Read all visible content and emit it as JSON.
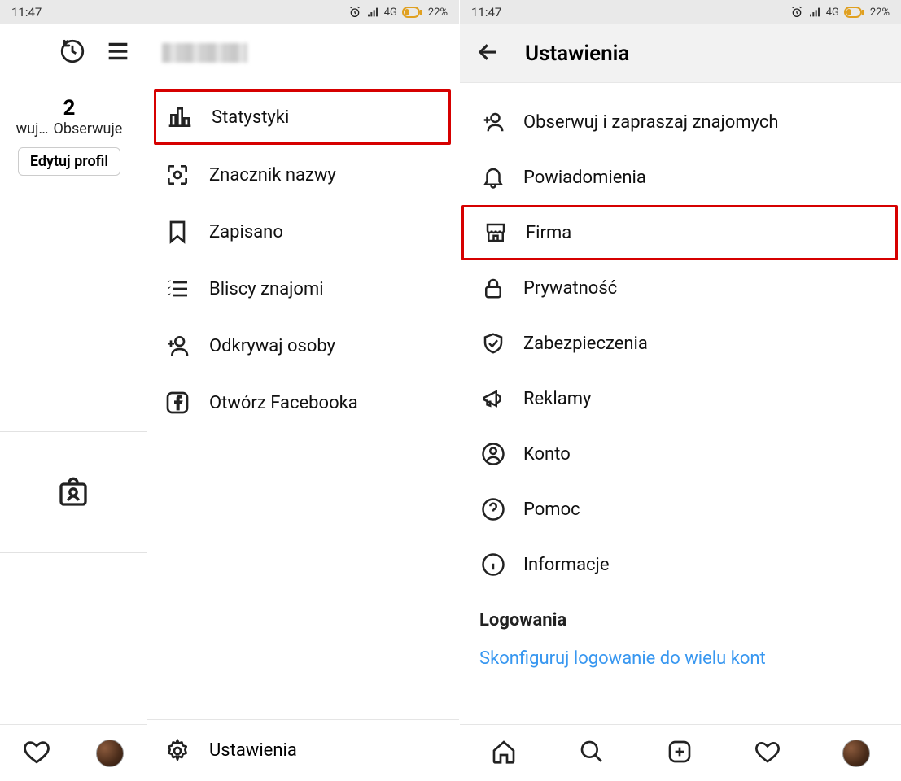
{
  "status": {
    "time": "11:47",
    "network": "4G",
    "battery_pct": "22%"
  },
  "left": {
    "stats": {
      "count": "2",
      "label_left": "wuj…",
      "label_right": "Obserwuje"
    },
    "edit_profile": "Edytuj profil",
    "menu": {
      "statistics": "Statystyki",
      "nametag": "Znacznik nazwy",
      "saved": "Zapisano",
      "close_friends": "Bliscy znajomi",
      "discover": "Odkrywaj osoby",
      "open_fb": "Otwórz Facebooka",
      "settings": "Ustawienia"
    }
  },
  "right": {
    "header": "Ustawienia",
    "items": {
      "follow_invite": "Obserwuj i zapraszaj znajomych",
      "notifications": "Powiadomienia",
      "business": "Firma",
      "privacy": "Prywatność",
      "security": "Zabezpieczenia",
      "ads": "Reklamy",
      "account": "Konto",
      "help": "Pomoc",
      "about": "Informacje"
    },
    "section_logins": "Logowania",
    "configure_login": "Skonfiguruj logowanie do wielu kont"
  }
}
